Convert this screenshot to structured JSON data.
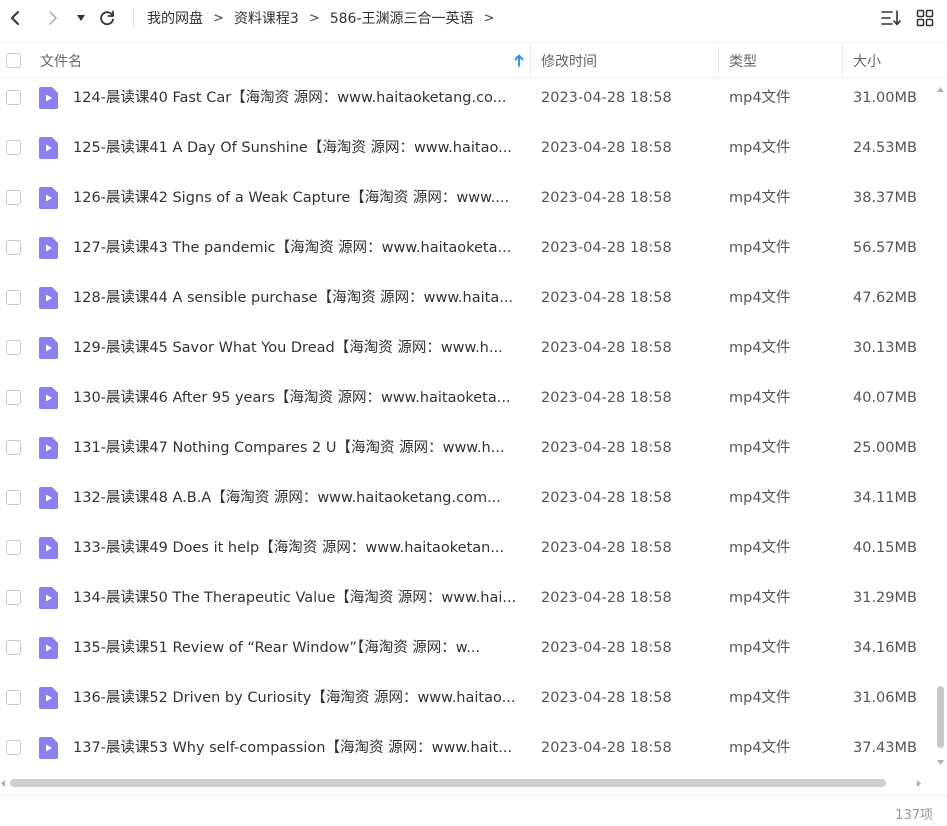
{
  "breadcrumb": [
    "我的网盘",
    "资料课程3",
    "586-王渊源三合一英语"
  ],
  "breadcrumb_separator": ">",
  "columns": {
    "name": "文件名",
    "modified": "修改时间",
    "type": "类型",
    "size": "大小"
  },
  "sort": {
    "column": "name",
    "direction": "ascending",
    "icon": "sort-up-arrow-icon"
  },
  "icons": {
    "back": "chevron-left-icon",
    "forward": "chevron-right-icon",
    "history": "caret-down-icon",
    "refresh": "refresh-icon",
    "sort_menu": "sort-list-icon",
    "view_grid": "grid-view-icon",
    "file": "video-file-icon"
  },
  "colors": {
    "file_icon": "#8b80f0",
    "sort_arrow": "#1f8fff",
    "accent_text": "#333333"
  },
  "files": [
    {
      "name": "124-晨读课40 Fast Car【海淘资 源网：www.haitaoketang.co...",
      "modified": "2023-04-28 18:58",
      "type": "mp4文件",
      "size": "31.00MB"
    },
    {
      "name": "125-晨读课41 A Day Of Sunshine【海淘资 源网：www.haitao...",
      "modified": "2023-04-28 18:58",
      "type": "mp4文件",
      "size": "24.53MB"
    },
    {
      "name": "126-晨读课42 Signs of a Weak Capture【海淘资 源网：www....",
      "modified": "2023-04-28 18:58",
      "type": "mp4文件",
      "size": "38.37MB"
    },
    {
      "name": "127-晨读课43 The pandemic【海淘资 源网：www.haitaoketa...",
      "modified": "2023-04-28 18:58",
      "type": "mp4文件",
      "size": "56.57MB"
    },
    {
      "name": "128-晨读课44 A sensible purchase【海淘资 源网：www.haita...",
      "modified": "2023-04-28 18:58",
      "type": "mp4文件",
      "size": "47.62MB"
    },
    {
      "name": "129-晨读课45 Savor What You Dread【海淘资 源网：www.h...",
      "modified": "2023-04-28 18:58",
      "type": "mp4文件",
      "size": "30.13MB"
    },
    {
      "name": "130-晨读课46 After 95 years【海淘资 源网：www.haitaoketa...",
      "modified": "2023-04-28 18:58",
      "type": "mp4文件",
      "size": "40.07MB"
    },
    {
      "name": "131-晨读课47 Nothing Compares 2 U【海淘资 源网：www.h...",
      "modified": "2023-04-28 18:58",
      "type": "mp4文件",
      "size": "25.00MB"
    },
    {
      "name": "132-晨读课48 A.B.A【海淘资 源网：www.haitaoketang.com...",
      "modified": "2023-04-28 18:58",
      "type": "mp4文件",
      "size": "34.11MB"
    },
    {
      "name": "133-晨读课49 Does it help【海淘资 源网：www.haitaoketan...",
      "modified": "2023-04-28 18:58",
      "type": "mp4文件",
      "size": "40.15MB"
    },
    {
      "name": "134-晨读课50 The Therapeutic Value【海淘资 源网：www.hai...",
      "modified": "2023-04-28 18:58",
      "type": "mp4文件",
      "size": "31.29MB"
    },
    {
      "name": "135-晨读课51 Review of “Rear Window”【海淘资 源网：w...",
      "modified": "2023-04-28 18:58",
      "type": "mp4文件",
      "size": "34.16MB"
    },
    {
      "name": "136-晨读课52 Driven by Curiosity【海淘资 源网：www.haitao...",
      "modified": "2023-04-28 18:58",
      "type": "mp4文件",
      "size": "31.06MB"
    },
    {
      "name": "137-晨读课53 Why self-compassion【海淘资 源网：www.hait...",
      "modified": "2023-04-28 18:58",
      "type": "mp4文件",
      "size": "37.43MB"
    }
  ],
  "footer": {
    "item_count": "137项"
  }
}
